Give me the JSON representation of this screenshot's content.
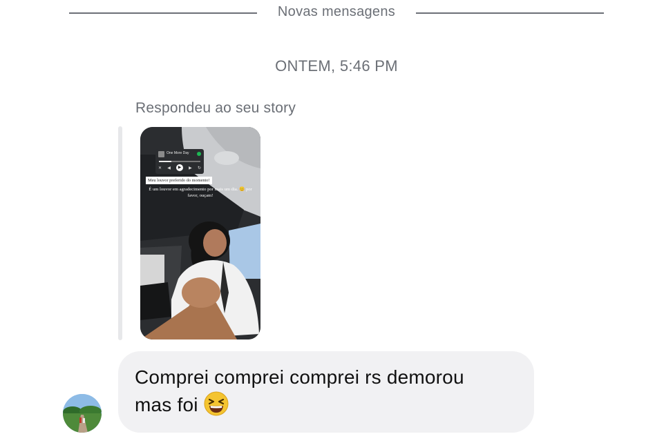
{
  "divider": {
    "label": "Novas mensagens"
  },
  "timestamp": "ONTEM, 5:46 PM",
  "reply": {
    "label": "Respondeu ao seu story",
    "story": {
      "music_title": "One More Day",
      "tag": "Meu louvor preferido do momento!",
      "caption": "É um louvor em agradecimento por mais um dia. 😊 por favor, ouçam!"
    }
  },
  "message": {
    "text": "Comprei comprei comprei rs demorou\nmas foi",
    "emoji": "grinning-squinting-face"
  },
  "colors": {
    "meta_text": "#6b6f76",
    "bubble_bg": "#f1f1f3",
    "reply_bar": "#e7e8ea",
    "emoji_yellow": "#f4c430"
  }
}
